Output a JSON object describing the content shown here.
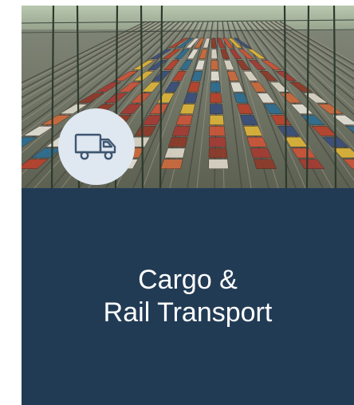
{
  "card": {
    "title_line1": "Cargo &",
    "title_line2": "Rail Transport",
    "icon": "truck-icon"
  },
  "colors": {
    "panel": "#223b55",
    "badge": "#dfe7f1",
    "icon_stroke": "#3f5670",
    "title_text": "#ffffff"
  }
}
